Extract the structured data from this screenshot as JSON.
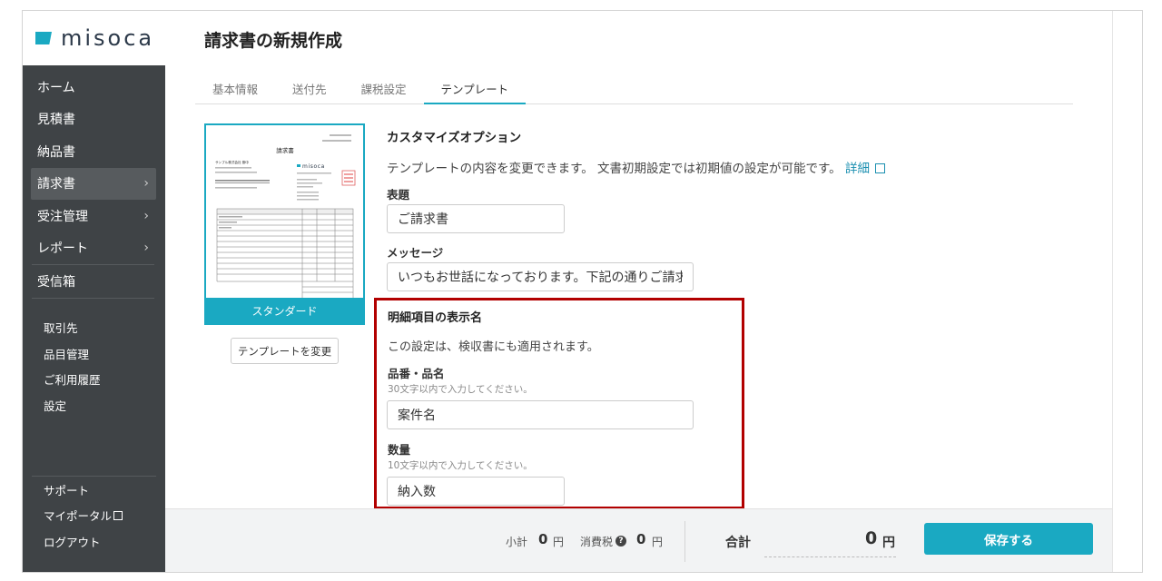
{
  "logo": {
    "text": "misoca"
  },
  "sidebar": {
    "main_items": [
      {
        "label": "ホーム",
        "chevron": false
      },
      {
        "label": "見積書",
        "chevron": false
      },
      {
        "label": "納品書",
        "chevron": false
      },
      {
        "label": "請求書",
        "chevron": true,
        "active": true
      },
      {
        "label": "受注管理",
        "chevron": true
      },
      {
        "label": "レポート",
        "chevron": true
      },
      {
        "label": "受信箱",
        "chevron": false
      }
    ],
    "sub_items": [
      {
        "label": "取引先"
      },
      {
        "label": "品目管理"
      },
      {
        "label": "ご利用履歴"
      },
      {
        "label": "設定"
      }
    ],
    "bottom_items": [
      {
        "label": "サポート"
      },
      {
        "label": "マイポータル"
      },
      {
        "label": "ログアウト"
      }
    ],
    "chevron_glyph": "›"
  },
  "page": {
    "title": "請求書の新規作成"
  },
  "tabs": [
    {
      "label": "基本情報"
    },
    {
      "label": "送付先"
    },
    {
      "label": "課税設定"
    },
    {
      "label": "テンプレート",
      "active": true
    }
  ],
  "template": {
    "caption": "スタンダード",
    "change_button": "テンプレートを変更",
    "preview": {
      "title": "請求書",
      "company": "サンプル株式会社 御中",
      "brand": "misoca"
    }
  },
  "customize": {
    "title": "カスタマイズオプション",
    "description": "テンプレートの内容を変更できます。 文書初期設定では初期値の設定が可能です。",
    "detail_link": "詳細",
    "heading_label": "表題",
    "heading_value": "ご請求書",
    "message_label": "メッセージ",
    "message_value": "いつもお世話になっております。下記の通りご請求申し上げます。"
  },
  "detail_names": {
    "title": "明細項目の表示名",
    "description": "この設定は、検収書にも適用されます。",
    "item_label": "品番・品名",
    "item_hint": "30文字以内で入力してください。",
    "item_value": "案件名",
    "qty_label": "数量",
    "qty_hint": "10文字以内で入力してください。",
    "qty_value": "納入数"
  },
  "footer": {
    "subtotal_label": "小計",
    "subtotal_value": "0",
    "tax_label": "消費税",
    "tax_value": "0",
    "yen": "円",
    "total_label": "合計",
    "total_value": "0",
    "save_button": "保存する"
  },
  "colors": {
    "accent": "#1aa9c2",
    "sidebar": "#3f4346",
    "highlight": "#b20000"
  }
}
